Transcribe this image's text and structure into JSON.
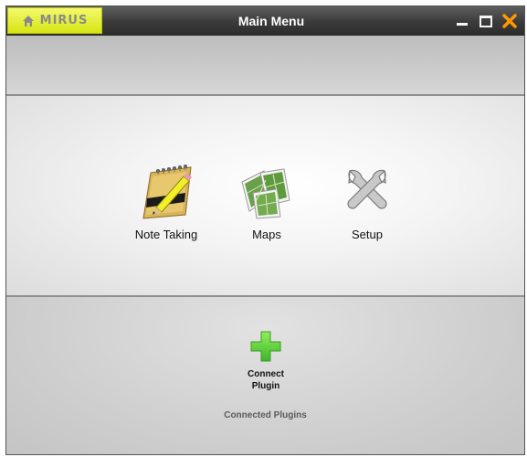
{
  "app": {
    "logo_text": "MIRUS",
    "title": "Main Menu",
    "controls": {
      "minimize_icon": "minimize-icon",
      "maximize_icon": "maximize-icon",
      "close_icon": "close-icon",
      "close_color": "#ff9900"
    }
  },
  "menu": {
    "items": [
      {
        "label": "Note Taking",
        "icon": "notepad-icon"
      },
      {
        "label": "Maps",
        "icon": "maps-icon"
      },
      {
        "label": "Setup",
        "icon": "wrench-icon"
      }
    ]
  },
  "plugins": {
    "connect_label": "Connect\nPlugin",
    "connect_icon": "green-plus-icon",
    "connected_label": "Connected Plugins"
  },
  "colors": {
    "logo_tab": "#e4ee2a",
    "plus_green": "#62d43a"
  }
}
